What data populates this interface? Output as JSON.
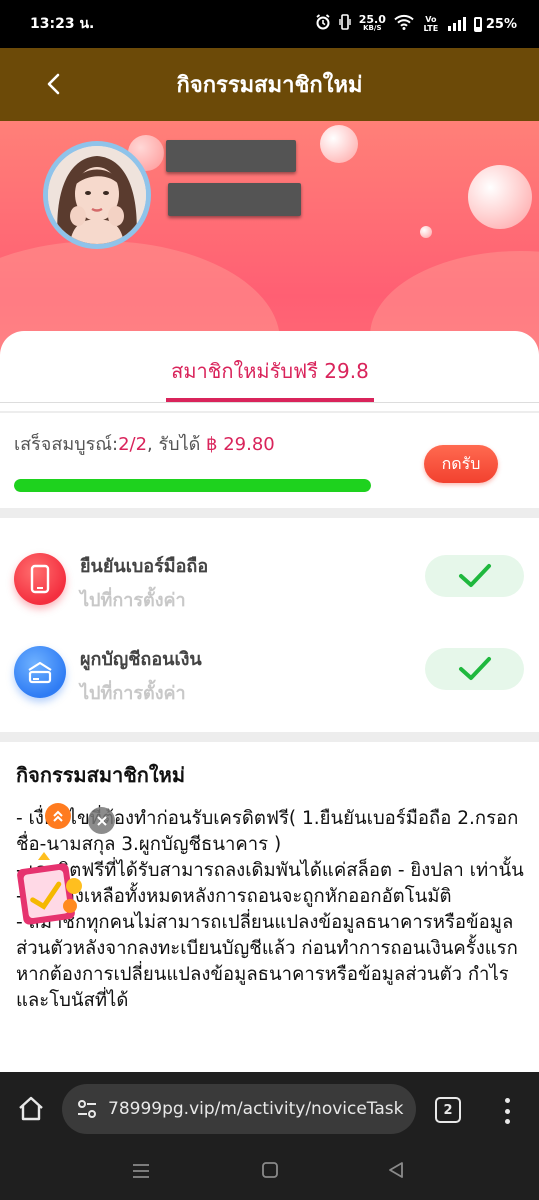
{
  "status_bar": {
    "time": "13:23 น.",
    "net_speed": "25.0",
    "net_unit": "KB/S",
    "volte": "Vo LTE",
    "battery": "25%"
  },
  "header": {
    "title": "กิจกรรมสมาชิกใหม่"
  },
  "tab": {
    "label": "สมาชิกใหม่รับฟรี 29.8"
  },
  "progress": {
    "prefix": "เสร็จสมบูรณ์:",
    "count": "2/2",
    "middle": ", รับได้ ",
    "amount": "฿ 29.80",
    "fraction": 1.0,
    "claim_label": "กดรับ"
  },
  "tasks": [
    {
      "title": "ยืนยันเบอร์มือถือ",
      "subtitle": "ไปที่การตั้งค่า",
      "icon": "phone-icon",
      "done": true
    },
    {
      "title": "ผูกบัญชีถอนเงิน",
      "subtitle": "ไปที่การตั้งค่า",
      "icon": "bank-card-icon",
      "done": true
    }
  ],
  "description": {
    "title": "กิจกรรมสมาชิกใหม่",
    "lines": [
      "- เงื่อนไขที่ต้องทำก่อนรับเครดิตฟรี( 1.ยืนยันเบอร์มือถือ  2.กรอกชื่อ-นามสกุล  3.ผูกบัญชีธนาคาร )",
      "- เครดิตฟรีที่ได้รับสามารถลงเดิมพันได้แค่สล็อต - ยิงปลา เท่านั้น",
      "- ยอดคงเหลือทั้งหมดหลังการถอนจะถูกหักออกอัตโนมัติ",
      "- สมาชิกทุกคนไม่สามารถเปลี่ยนแปลงข้อมูลธนาคารหรือข้อมูลส่วนตัวหลังจากลงทะเบียนบัญชีแล้ว ก่อนทำการถอนเงินครั้งแรก หากต้องการเปลี่ยนแปลงข้อมูลธนาคารหรือข้อมูลส่วนตัว กำไรและโบนัสที่ได้"
    ]
  },
  "browser": {
    "url": "78999pg.vip/m/activity/noviceTask",
    "tab_count": "2"
  },
  "colors": {
    "header_bg": "#6c4a08",
    "accent": "#d9245b",
    "progress_fill": "#1ed21e",
    "claim_button": "#f2412f",
    "check": "#1fb83e"
  }
}
